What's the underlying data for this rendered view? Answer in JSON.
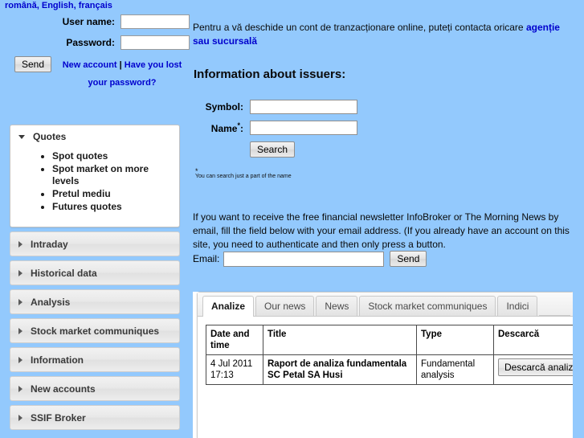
{
  "languages": {
    "items": [
      {
        "label": "română"
      },
      {
        "label": "English"
      },
      {
        "label": "français"
      }
    ],
    "separator": ", "
  },
  "login": {
    "username_label": "User name:",
    "username_value": "",
    "password_label": "Password:",
    "password_value": "",
    "send_label": "Send",
    "new_account_label": "New account",
    "pipe": "|",
    "lost_password_label": "Have you lost your password?"
  },
  "sidebar": {
    "open_panel": {
      "title": "Quotes",
      "items": [
        "Spot quotes",
        "Spot market on more levels",
        "Pretul mediu",
        "Futures quotes"
      ]
    },
    "closed_panels": [
      {
        "title": "Intraday"
      },
      {
        "title": "Historical data"
      },
      {
        "title": "Analysis"
      },
      {
        "title": "Stock market communiques"
      },
      {
        "title": "Information"
      },
      {
        "title": "New accounts"
      },
      {
        "title": "SSIF Broker"
      }
    ]
  },
  "main": {
    "intro_text_before": "Pentru a vă deschide un cont de tranzacționare online, puteți contacta oricare ",
    "intro_link": "agenție sau sucursală",
    "section_title": "Information about issuers:",
    "issuer_form": {
      "symbol_label": "Symbol:",
      "symbol_value": "",
      "name_label": "Name",
      "name_label_suffix": ":",
      "name_value": "",
      "search_label": "Search"
    },
    "footnote_star": "*",
    "footnote_text": "You can search just a part of the name",
    "newsletter_text": "If you want to receive the free financial newsletter InfoBroker or The Morning News by email, fill the field below with your email address. (If you already have an account on this site, you need to authenticate and then only press a button.",
    "email_label": "Email:",
    "email_value": "",
    "email_send_label": "Send"
  },
  "tabs": {
    "items": [
      {
        "label": "Analize",
        "active": true
      },
      {
        "label": "Our news",
        "active": false
      },
      {
        "label": "News",
        "active": false
      },
      {
        "label": "Stock market communiques",
        "active": false
      },
      {
        "label": "Indici",
        "active": false
      }
    ]
  },
  "table": {
    "headers": [
      "Date and time",
      "Title",
      "Type",
      "Descarcă"
    ],
    "rows": [
      {
        "datetime": "4 Jul 2011 17:13",
        "title": "Raport de analiza fundamentala SC Petal SA Husi",
        "type": "Fundamental analysis",
        "download_label": "Descarcă analiza"
      }
    ]
  },
  "colors": {
    "page_background": "#93c9fd",
    "link": "#0000cd",
    "panel_background": "#ffffff",
    "text": "#0a0a0a"
  }
}
